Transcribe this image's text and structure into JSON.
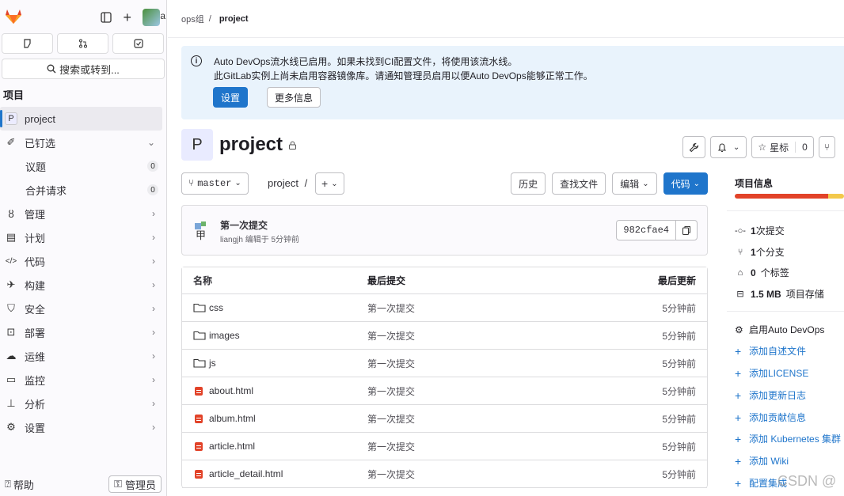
{
  "sidebar": {
    "search_label": "搜索或转到...",
    "section_title": "项目",
    "project_name": "project",
    "project_initial": "P",
    "pinned_label": "已钉选",
    "pinned_items": [
      {
        "label": "议题",
        "count": "0"
      },
      {
        "label": "合并请求",
        "count": "0"
      }
    ],
    "nav_items": [
      {
        "label": "管理",
        "icon": "users-icon"
      },
      {
        "label": "计划",
        "icon": "calendar-icon"
      },
      {
        "label": "代码",
        "icon": "code-icon"
      },
      {
        "label": "构建",
        "icon": "rocket-icon"
      },
      {
        "label": "安全",
        "icon": "shield-icon"
      },
      {
        "label": "部署",
        "icon": "deploy-icon"
      },
      {
        "label": "运维",
        "icon": "cloud-icon"
      },
      {
        "label": "监控",
        "icon": "monitor-icon"
      },
      {
        "label": "分析",
        "icon": "chart-icon"
      },
      {
        "label": "设置",
        "icon": "settings-icon"
      }
    ],
    "help_label": "帮助",
    "admin_label": "管理员"
  },
  "breadcrumb": {
    "group": "ops组",
    "separator": "/",
    "project": "project"
  },
  "alert": {
    "line1": "Auto DevOps流水线已启用。如果未找到CI配置文件，将使用该流水线。",
    "line2": "此GitLab实例上尚未启用容器镜像库。请通知管理员启用以便Auto DevOps能够正常工作。",
    "primary_button": "设置",
    "secondary_button": "更多信息"
  },
  "project": {
    "initial": "P",
    "title": "project"
  },
  "header_actions": {
    "star_label": "星标",
    "star_count": "0"
  },
  "toolbar": {
    "branch": "master",
    "path": "project",
    "path_sep": "/",
    "plus": "+",
    "history": "历史",
    "find_file": "查找文件",
    "edit": "编辑",
    "code": "代码"
  },
  "last_commit": {
    "title": "第一次提交",
    "meta": "liangjh 编辑于 5分钟前",
    "sha": "982cfae4"
  },
  "file_table": {
    "headers": {
      "name": "名称",
      "commit": "最后提交",
      "updated": "最后更新"
    },
    "rows": [
      {
        "name": "css",
        "type": "folder",
        "commit": "第一次提交",
        "updated": "5分钟前"
      },
      {
        "name": "images",
        "type": "folder",
        "commit": "第一次提交",
        "updated": "5分钟前"
      },
      {
        "name": "js",
        "type": "folder",
        "commit": "第一次提交",
        "updated": "5分钟前"
      },
      {
        "name": "about.html",
        "type": "html",
        "commit": "第一次提交",
        "updated": "5分钟前"
      },
      {
        "name": "album.html",
        "type": "html",
        "commit": "第一次提交",
        "updated": "5分钟前"
      },
      {
        "name": "article.html",
        "type": "html",
        "commit": "第一次提交",
        "updated": "5分钟前"
      },
      {
        "name": "article_detail.html",
        "type": "html",
        "commit": "第一次提交",
        "updated": "5分钟前"
      }
    ]
  },
  "project_info": {
    "title": "项目信息",
    "stats": [
      {
        "icon": "commit-icon",
        "value": "1",
        "label": "次提交"
      },
      {
        "icon": "branch-icon",
        "value": "1",
        "label": "个分支"
      },
      {
        "icon": "tag-icon",
        "value": "0",
        "label": "个标签"
      },
      {
        "icon": "storage-icon",
        "value": "1.5 MB",
        "label": "项目存储"
      }
    ],
    "auto_devops": "启用Auto DevOps",
    "links": [
      "添加自述文件",
      "添加LICENSE",
      "添加更新日志",
      "添加贡献信息",
      "添加 Kubernetes 集群",
      "添加 Wiki",
      "配置集成"
    ]
  },
  "watermark": "CSDN @"
}
